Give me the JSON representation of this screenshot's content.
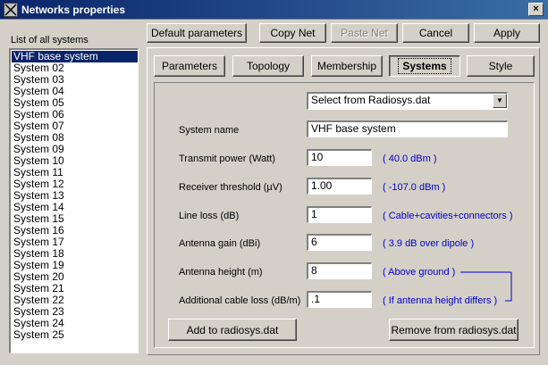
{
  "window": {
    "title": "Networks properties",
    "close_glyph": "×"
  },
  "left": {
    "list_label": "List of all systems",
    "systems": [
      "VHF base system",
      "System 02",
      "System 03",
      "System 04",
      "System 05",
      "System 06",
      "System 07",
      "System 08",
      "System 09",
      "System 10",
      "System 11",
      "System 12",
      "System 13",
      "System 14",
      "System 15",
      "System 16",
      "System 17",
      "System 18",
      "System 19",
      "System 20",
      "System 21",
      "System 22",
      "System 23",
      "System 24",
      "System 25"
    ],
    "selected_index": 0
  },
  "toolbar": {
    "default_params": "Default parameters",
    "copy_net": "Copy Net",
    "paste_net": "Paste Net",
    "cancel": "Cancel",
    "apply": "Apply"
  },
  "tabs": {
    "parameters": "Parameters",
    "topology": "Topology",
    "membership": "Membership",
    "systems": "Systems",
    "style": "Style",
    "active": "systems"
  },
  "form": {
    "select_value": "Select from Radiosys.dat",
    "system_name_label": "System name",
    "system_name_value": "VHF base system",
    "transmit_power_label": "Transmit power (Watt)",
    "transmit_power_value": "10",
    "transmit_power_note": "( 40.0 dBm )",
    "receiver_threshold_label": "Receiver threshold (µV)",
    "receiver_threshold_value": "1.00",
    "receiver_threshold_note": "( -107.0 dBm )",
    "line_loss_label": "Line loss (dB)",
    "line_loss_value": "1",
    "line_loss_note": "( Cable+cavities+connectors )",
    "antenna_gain_label": "Antenna gain (dBi)",
    "antenna_gain_value": "6",
    "antenna_gain_note": "( 3.9 dB over dipole )",
    "antenna_height_label": "Antenna height (m)",
    "antenna_height_value": "8",
    "antenna_height_note": "( Above ground )",
    "cable_loss_label": "Additional cable loss (dB/m)",
    "cable_loss_value": ".1",
    "cable_loss_note": "( If antenna height differs )",
    "add_button": "Add to radiosys.dat",
    "remove_button": "Remove from radiosys.dat"
  },
  "colors": {
    "title_bar": "#0a246a",
    "note_text": "#0000cc",
    "face": "#d4d0c8",
    "selection": "#0a246a"
  }
}
